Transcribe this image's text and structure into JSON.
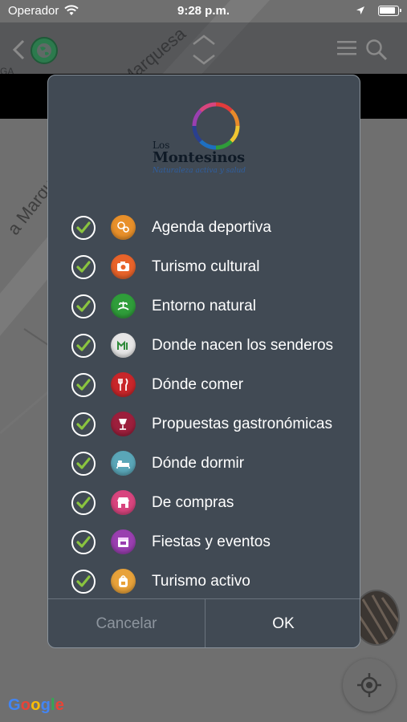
{
  "status_bar": {
    "carrier": "Operador",
    "time": "9:28 p.m."
  },
  "map": {
    "street_top": "Marquesa",
    "street_left": "a Marque",
    "fragment": "GA"
  },
  "dialog": {
    "logo": {
      "los": "Los",
      "name": "Montesinos",
      "tagline": "Naturaleza activa y salud"
    },
    "categories": [
      {
        "label": "Agenda deportiva",
        "checked": true,
        "icon": "sports-agenda-icon",
        "color": "#e8902a"
      },
      {
        "label": "Turismo cultural",
        "checked": true,
        "icon": "camera-icon",
        "color": "#e8632a"
      },
      {
        "label": "Entorno natural",
        "checked": true,
        "icon": "nature-icon",
        "color": "#2f9d3a"
      },
      {
        "label": "Donde nacen los senderos",
        "checked": true,
        "icon": "trail-icon",
        "color": "#e6e6e6"
      },
      {
        "label": "Dónde comer",
        "checked": true,
        "icon": "fork-knife-icon",
        "color": "#c8262a"
      },
      {
        "label": "Propuestas gastronómicas",
        "checked": true,
        "icon": "wine-glass-icon",
        "color": "#9c1f3c"
      },
      {
        "label": "Dónde dormir",
        "checked": true,
        "icon": "bed-icon",
        "color": "#5aa6b8"
      },
      {
        "label": "De compras",
        "checked": true,
        "icon": "shop-icon",
        "color": "#d8457e"
      },
      {
        "label": "Fiestas y eventos",
        "checked": true,
        "icon": "calendar-icon",
        "color": "#9a3fb0"
      },
      {
        "label": "Turismo activo",
        "checked": true,
        "icon": "backpack-icon",
        "color": "#e8a23a"
      }
    ],
    "cancel_label": "Cancelar",
    "ok_label": "OK"
  },
  "google_logo": "Google",
  "colors": {
    "dialog_bg": "#414a54",
    "check_green": "#8ac43f"
  }
}
